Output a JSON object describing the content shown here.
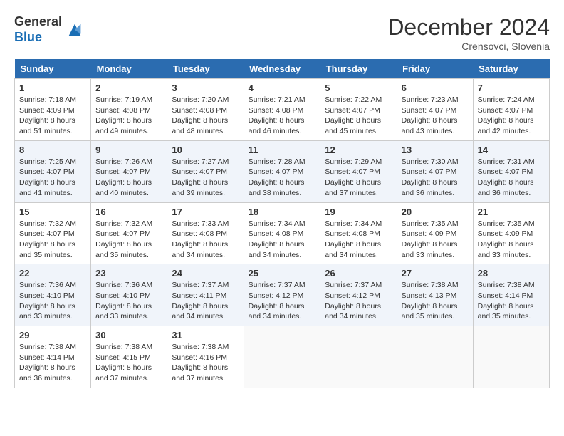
{
  "header": {
    "logo_general": "General",
    "logo_blue": "Blue",
    "month_title": "December 2024",
    "location": "Crensovci, Slovenia"
  },
  "calendar": {
    "days_of_week": [
      "Sunday",
      "Monday",
      "Tuesday",
      "Wednesday",
      "Thursday",
      "Friday",
      "Saturday"
    ],
    "weeks": [
      [
        {
          "day": "1",
          "sunrise": "7:18 AM",
          "sunset": "4:09 PM",
          "daylight": "8 hours and 51 minutes."
        },
        {
          "day": "2",
          "sunrise": "7:19 AM",
          "sunset": "4:08 PM",
          "daylight": "8 hours and 49 minutes."
        },
        {
          "day": "3",
          "sunrise": "7:20 AM",
          "sunset": "4:08 PM",
          "daylight": "8 hours and 48 minutes."
        },
        {
          "day": "4",
          "sunrise": "7:21 AM",
          "sunset": "4:08 PM",
          "daylight": "8 hours and 46 minutes."
        },
        {
          "day": "5",
          "sunrise": "7:22 AM",
          "sunset": "4:07 PM",
          "daylight": "8 hours and 45 minutes."
        },
        {
          "day": "6",
          "sunrise": "7:23 AM",
          "sunset": "4:07 PM",
          "daylight": "8 hours and 43 minutes."
        },
        {
          "day": "7",
          "sunrise": "7:24 AM",
          "sunset": "4:07 PM",
          "daylight": "8 hours and 42 minutes."
        }
      ],
      [
        {
          "day": "8",
          "sunrise": "7:25 AM",
          "sunset": "4:07 PM",
          "daylight": "8 hours and 41 minutes."
        },
        {
          "day": "9",
          "sunrise": "7:26 AM",
          "sunset": "4:07 PM",
          "daylight": "8 hours and 40 minutes."
        },
        {
          "day": "10",
          "sunrise": "7:27 AM",
          "sunset": "4:07 PM",
          "daylight": "8 hours and 39 minutes."
        },
        {
          "day": "11",
          "sunrise": "7:28 AM",
          "sunset": "4:07 PM",
          "daylight": "8 hours and 38 minutes."
        },
        {
          "day": "12",
          "sunrise": "7:29 AM",
          "sunset": "4:07 PM",
          "daylight": "8 hours and 37 minutes."
        },
        {
          "day": "13",
          "sunrise": "7:30 AM",
          "sunset": "4:07 PM",
          "daylight": "8 hours and 36 minutes."
        },
        {
          "day": "14",
          "sunrise": "7:31 AM",
          "sunset": "4:07 PM",
          "daylight": "8 hours and 36 minutes."
        }
      ],
      [
        {
          "day": "15",
          "sunrise": "7:32 AM",
          "sunset": "4:07 PM",
          "daylight": "8 hours and 35 minutes."
        },
        {
          "day": "16",
          "sunrise": "7:32 AM",
          "sunset": "4:07 PM",
          "daylight": "8 hours and 35 minutes."
        },
        {
          "day": "17",
          "sunrise": "7:33 AM",
          "sunset": "4:08 PM",
          "daylight": "8 hours and 34 minutes."
        },
        {
          "day": "18",
          "sunrise": "7:34 AM",
          "sunset": "4:08 PM",
          "daylight": "8 hours and 34 minutes."
        },
        {
          "day": "19",
          "sunrise": "7:34 AM",
          "sunset": "4:08 PM",
          "daylight": "8 hours and 34 minutes."
        },
        {
          "day": "20",
          "sunrise": "7:35 AM",
          "sunset": "4:09 PM",
          "daylight": "8 hours and 33 minutes."
        },
        {
          "day": "21",
          "sunrise": "7:35 AM",
          "sunset": "4:09 PM",
          "daylight": "8 hours and 33 minutes."
        }
      ],
      [
        {
          "day": "22",
          "sunrise": "7:36 AM",
          "sunset": "4:10 PM",
          "daylight": "8 hours and 33 minutes."
        },
        {
          "day": "23",
          "sunrise": "7:36 AM",
          "sunset": "4:10 PM",
          "daylight": "8 hours and 33 minutes."
        },
        {
          "day": "24",
          "sunrise": "7:37 AM",
          "sunset": "4:11 PM",
          "daylight": "8 hours and 34 minutes."
        },
        {
          "day": "25",
          "sunrise": "7:37 AM",
          "sunset": "4:12 PM",
          "daylight": "8 hours and 34 minutes."
        },
        {
          "day": "26",
          "sunrise": "7:37 AM",
          "sunset": "4:12 PM",
          "daylight": "8 hours and 34 minutes."
        },
        {
          "day": "27",
          "sunrise": "7:38 AM",
          "sunset": "4:13 PM",
          "daylight": "8 hours and 35 minutes."
        },
        {
          "day": "28",
          "sunrise": "7:38 AM",
          "sunset": "4:14 PM",
          "daylight": "8 hours and 35 minutes."
        }
      ],
      [
        {
          "day": "29",
          "sunrise": "7:38 AM",
          "sunset": "4:14 PM",
          "daylight": "8 hours and 36 minutes."
        },
        {
          "day": "30",
          "sunrise": "7:38 AM",
          "sunset": "4:15 PM",
          "daylight": "8 hours and 37 minutes."
        },
        {
          "day": "31",
          "sunrise": "7:38 AM",
          "sunset": "4:16 PM",
          "daylight": "8 hours and 37 minutes."
        },
        null,
        null,
        null,
        null
      ]
    ]
  }
}
